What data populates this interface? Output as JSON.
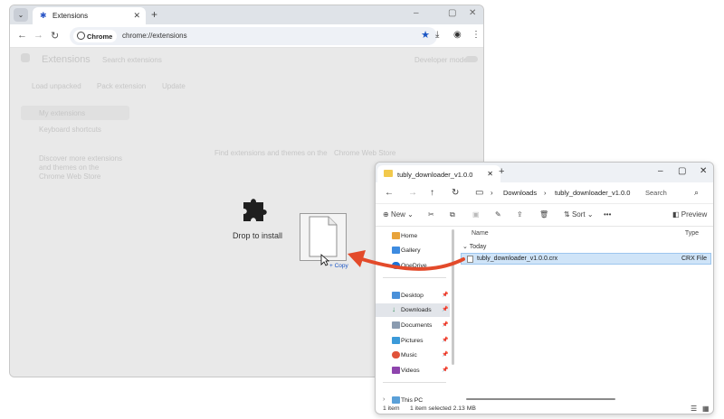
{
  "chrome": {
    "tab_title": "Extensions",
    "new_tab": "+",
    "win_min": "–",
    "win_max": "▢",
    "win_close": "✕",
    "chip_label": "Chrome",
    "url": "chrome://extensions",
    "page": {
      "title": "Extensions",
      "search_placeholder": "Search extensions",
      "dev_mode": "Developer mode",
      "actions": [
        "Load unpacked",
        "Pack extension",
        "Update"
      ],
      "sidebar": [
        "My extensions",
        "Keyboard shortcuts"
      ],
      "sidebar_promo": [
        "Discover more extensions",
        "and themes on the",
        "Chrome Web Store"
      ],
      "web_store_hint": "Find extensions and themes on the",
      "web_store_link": "Chrome Web Store",
      "drop_label": "Drop to install",
      "copy_label": "Copy"
    }
  },
  "explorer": {
    "tab_title": "tubly_downloader_v1.0.0",
    "new_tab": "+",
    "win_min": "–",
    "win_max": "▢",
    "win_close": "✕",
    "breadcrumb": [
      "Downloads",
      "tubly_downloader_v1.0.0"
    ],
    "search_placeholder": "Search",
    "commands": {
      "new": "New",
      "sort": "Sort",
      "more": "•••",
      "preview": "Preview"
    },
    "sidebar": {
      "home": "Home",
      "gallery": "Gallery",
      "onedrive": "OneDrive",
      "desktop": "Desktop",
      "downloads": "Downloads",
      "documents": "Documents",
      "pictures": "Pictures",
      "music": "Music",
      "videos": "Videos",
      "this_pc": "This PC"
    },
    "columns": {
      "name": "Name",
      "type": "Type"
    },
    "group": "Today",
    "file": {
      "name": "tubly_downloader_v1.0.0.crx",
      "type": "CRX File"
    },
    "status": {
      "count": "1 item",
      "selected": "1 item selected  2.13 MB"
    }
  },
  "colors": {
    "accent": "#1a55c4",
    "arrow": "#e34a2a",
    "selection": "#cfe4f8"
  }
}
